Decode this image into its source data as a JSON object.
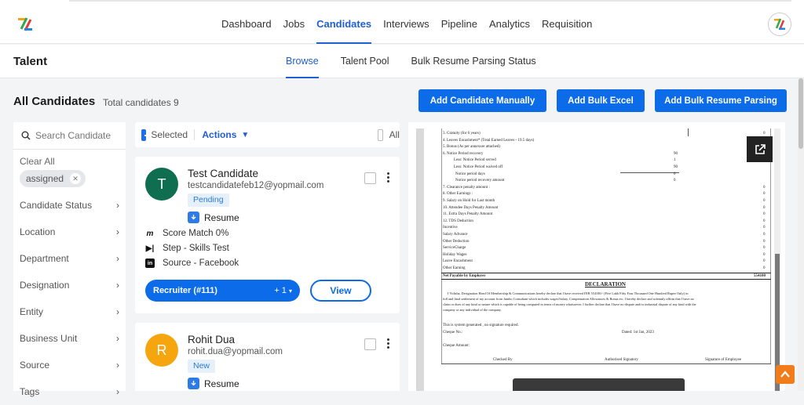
{
  "nav": {
    "items": [
      "Dashboard",
      "Jobs",
      "Candidates",
      "Interviews",
      "Pipeline",
      "Analytics",
      "Requisition"
    ],
    "active": "Candidates"
  },
  "subnav": {
    "title": "Talent",
    "tabs": [
      "Browse",
      "Talent Pool",
      "Bulk Resume Parsing Status"
    ],
    "active": "Browse"
  },
  "main": {
    "heading": "All Candidates",
    "total": "Total candidates 9",
    "buttons": {
      "add_manual": "Add Candidate Manually",
      "add_bulk_excel": "Add Bulk Excel",
      "add_bulk_resume": "Add Bulk Resume Parsing"
    }
  },
  "filters": {
    "search_placeholder": "Search Candidate",
    "clear_all": "Clear All",
    "chip": "assigned",
    "items": [
      "Candidate Status",
      "Location",
      "Department",
      "Designation",
      "Entity",
      "Business Unit",
      "Source",
      "Tags"
    ]
  },
  "listhead": {
    "selected": "Selected",
    "actions": "Actions",
    "all": "All"
  },
  "candidates": [
    {
      "initial": "T",
      "name": "Test Candidate",
      "email": "testcandidatefeb12@yopmail.com",
      "status": "Pending",
      "resume": "Resume",
      "score": "Score Match 0%",
      "step": "Step - Skills Test",
      "source": "Source - Facebook",
      "recruiter": "Recruiter (#111)",
      "recruiter_more": "+ 1",
      "view": "View",
      "color": "#0f6e4f"
    },
    {
      "initial": "R",
      "name": "Rohit Dua",
      "email": "rohit.dua@yopmail.com",
      "status": "New",
      "resume": "Resume",
      "color": "#f5a60f"
    }
  ],
  "document": {
    "lines": [
      "3. Gratuity (for 6 years)",
      "4. Leaves Encashment*        (Total Earned Leaves - 19.5 days)",
      "5. Bonus        (As per annexure attached)",
      "6. Notice Period recovery",
      "Less: Notice Period served",
      "Less: Notice Period waived off",
      "Notice period days",
      "Notice period recovery amount",
      "7. Clearance penalty amount :",
      "8. Other Earnings :",
      "9. Salary on Hold for Last month",
      "10. Attendee Days Penalty Amount",
      "11. Extra Days Penalty Amount",
      "12. TDS Deduction",
      "Incentive",
      "Salary Advance",
      "Other Deduction",
      "ServiceCharge",
      "Holiday Wages",
      "Leave Encashment",
      "Other Earning"
    ],
    "notice_values": [
      "90",
      "1",
      "90",
      "0",
      "0"
    ],
    "net_label": "Net Payable by Employer",
    "net_value": "554100",
    "declaration_title": "DECLARATION",
    "declaration_lines": [
      "I Vidisha, Designation Head Of Membership & Communications hereby declare that I have received INR 554100/- (Five Lakh Fifty Four Thousand One Hundred Rupee Only) in",
      "full and final settlement of my account from Jumbo Consultant which includes wages/Salary, Compensation Allowances & Bonus etc. I hereby declare and solemnly affirm that I have no",
      "claim or dues of any kind or nature which is capable of being computed in terms of money whatsoever. I further declare that I have no dispute and/or industrial dispute of any kind with the",
      "company or any individual of the company."
    ],
    "system_generated": "This is system generated , no signature required.",
    "cheque_no": "Cheque No.:",
    "dated": "Dated:  1st Jan, 2023",
    "cheque_amount": "Cheque Amount:",
    "signatures": [
      "Checked By",
      "Authorised Signatory",
      "Signature of Employee"
    ]
  }
}
